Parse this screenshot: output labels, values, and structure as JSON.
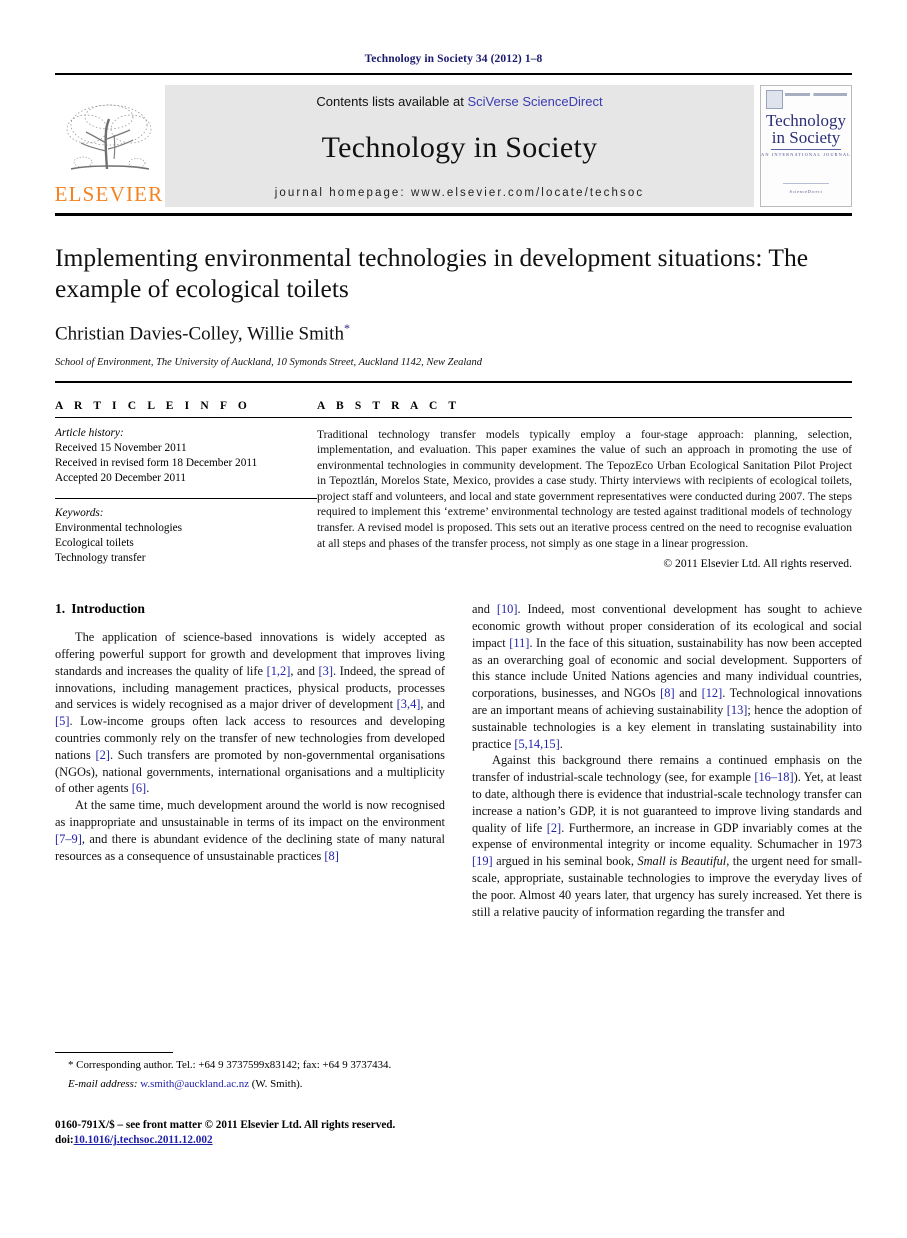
{
  "running_head": "Technology in Society 34 (2012) 1–8",
  "masthead": {
    "contents_prefix": "Contents lists available at ",
    "contents_link": "SciVerse ScienceDirect",
    "journal_name": "Technology in Society",
    "homepage": "journal homepage: www.elsevier.com/locate/techsoc",
    "publisher_wordmark": "ELSEVIER",
    "publisher_color": "#F58220",
    "link_color": "#3b3bb3",
    "cover": {
      "line1": "Technology",
      "line2": "in Society",
      "subtitle": "AN INTERNATIONAL JOURNAL",
      "footer": "ScienceDirect"
    }
  },
  "article": {
    "title": "Implementing environmental technologies in development situations: The example of ecological toilets",
    "authors": "Christian Davies-Colley, Willie Smith",
    "corresponding_marker": "*",
    "affiliation": "School of Environment, The University of Auckland, 10 Symonds Street, Auckland 1142, New Zealand"
  },
  "article_info": {
    "heading": "A R T I C L E   I N F O",
    "history_label": "Article history:",
    "history": [
      "Received 15 November 2011",
      "Received in revised form 18 December 2011",
      "Accepted 20 December 2011"
    ],
    "keywords_label": "Keywords:",
    "keywords": [
      "Environmental technologies",
      "Ecological toilets",
      "Technology transfer"
    ]
  },
  "abstract": {
    "heading": "A B S T R A C T",
    "text": "Traditional technology transfer models typically employ a four-stage approach: planning, selection, implementation, and evaluation. This paper examines the value of such an approach in promoting the use of environmental technologies in community development. The TepozEco Urban Ecological Sanitation Pilot Project in Tepoztlán, Morelos State, Mexico, provides a case study. Thirty interviews with recipients of ecological toilets, project staff and volunteers, and local and state government representatives were conducted during 2007. The steps required to implement this ‘extreme’ environmental technology are tested against traditional models of technology transfer. A revised model is proposed. This sets out an iterative process centred on the need to recognise evaluation at all steps and phases of the transfer process, not simply as one stage in a linear progression.",
    "copyright": "© 2011 Elsevier Ltd. All rights reserved."
  },
  "body": {
    "section_number": "1.",
    "section_title": "Introduction",
    "left_paragraphs": [
      {
        "segments": [
          {
            "t": "The application of science-based innovations is widely accepted as offering powerful support for growth and development that improves living standards and increases the quality of life "
          },
          {
            "t": "[1,2]",
            "c": "cite"
          },
          {
            "t": ", and "
          },
          {
            "t": "[3]",
            "c": "cite"
          },
          {
            "t": ". Indeed, the spread of innovations, including management practices, physical products, processes and services is widely recognised as a major driver of development "
          },
          {
            "t": "[3,4]",
            "c": "cite"
          },
          {
            "t": ", and "
          },
          {
            "t": "[5]",
            "c": "cite"
          },
          {
            "t": ". Low-income groups often lack access to resources and developing countries commonly rely on the transfer of new technologies from developed nations "
          },
          {
            "t": "[2]",
            "c": "cite"
          },
          {
            "t": ". Such transfers are promoted by non-governmental organisations (NGOs), national governments, international organisations and a multiplicity of other agents "
          },
          {
            "t": "[6]",
            "c": "cite"
          },
          {
            "t": "."
          }
        ]
      },
      {
        "segments": [
          {
            "t": "At the same time, much development around the world is now recognised as inappropriate and unsustainable in terms of its impact on the environment "
          },
          {
            "t": "[7–9]",
            "c": "cite"
          },
          {
            "t": ", and there is abundant evidence of the declining state of many natural resources as a consequence of unsustainable practices "
          },
          {
            "t": "[8]",
            "c": "cite"
          }
        ]
      }
    ],
    "right_paragraphs": [
      {
        "no_indent": true,
        "segments": [
          {
            "t": "and "
          },
          {
            "t": "[10]",
            "c": "cite"
          },
          {
            "t": ". Indeed, most conventional development has sought to achieve economic growth without proper consideration of its ecological and social impact "
          },
          {
            "t": "[11]",
            "c": "cite"
          },
          {
            "t": ". In the face of this situation, sustainability has now been accepted as an overarching goal of economic and social development. Supporters of this stance include United Nations agencies and many individual countries, corporations, businesses, and NGOs "
          },
          {
            "t": "[8]",
            "c": "cite"
          },
          {
            "t": " and "
          },
          {
            "t": "[12]",
            "c": "cite"
          },
          {
            "t": ". Technological innovations are an important means of achieving sustainability "
          },
          {
            "t": "[13]",
            "c": "cite"
          },
          {
            "t": "; hence the adoption of sustainable technologies is a key element in translating sustainability into practice "
          },
          {
            "t": "[5,14,15]",
            "c": "cite"
          },
          {
            "t": "."
          }
        ]
      },
      {
        "segments": [
          {
            "t": "Against this background there remains a continued emphasis on the transfer of industrial-scale technology (see, for example "
          },
          {
            "t": "[16–18]",
            "c": "cite"
          },
          {
            "t": "). Yet, at least to date, although there is evidence that industrial-scale technology transfer can increase a nation’s GDP, it is not guaranteed to improve living standards and quality of life "
          },
          {
            "t": "[2]",
            "c": "cite"
          },
          {
            "t": ". Furthermore, an increase in GDP invariably comes at the expense of environmental integrity or income equality. Schumacher in 1973 "
          },
          {
            "t": "[19]",
            "c": "cite"
          },
          {
            "t": " argued in his seminal book, "
          },
          {
            "t": "Small is Beautiful",
            "c": "ital"
          },
          {
            "t": ", the urgent need for small-scale, appropriate, sustainable technologies to improve the everyday lives of the poor. Almost 40 years later, that urgency has surely increased. Yet there is still a relative paucity of information regarding the transfer and"
          }
        ]
      }
    ]
  },
  "footnotes": {
    "corresponding": {
      "marker": "*",
      "text": " Corresponding author. Tel.: +64 9 3737599x83142; fax: +64 9 3737434."
    },
    "email": {
      "label": "E-mail address:",
      "address": "w.smith@auckland.ac.nz",
      "suffix": " (W. Smith)."
    }
  },
  "imprint": {
    "issn_line": "0160-791X/$ – see front matter © 2011 Elsevier Ltd. All rights reserved.",
    "doi_label": "doi:",
    "doi_value": "10.1016/j.techsoc.2011.12.002"
  }
}
